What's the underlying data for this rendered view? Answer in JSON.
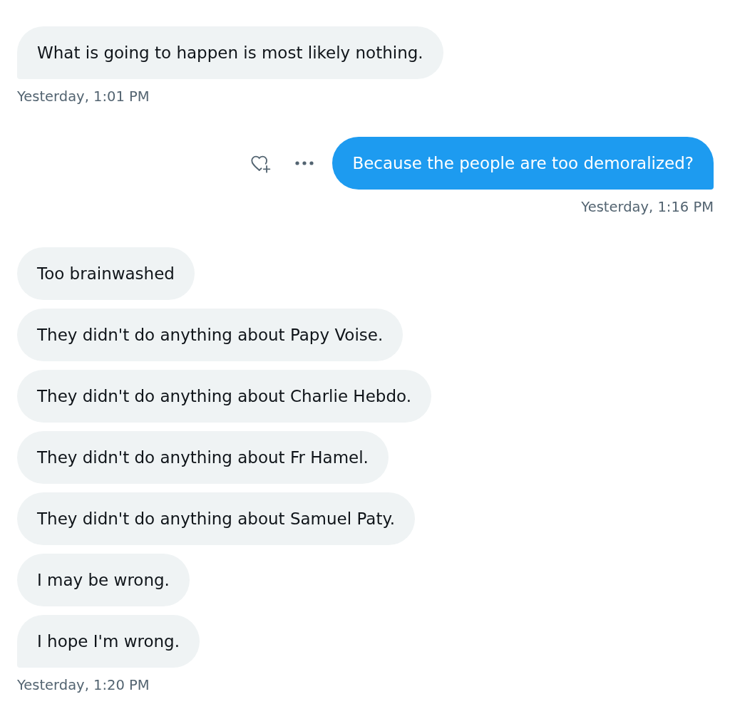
{
  "messages": [
    {
      "kind": "received",
      "bubbles": [
        {
          "text": "What is going to happen is most likely nothing.",
          "hovered": false
        }
      ],
      "timestamp": "Yesterday, 1:01 PM"
    },
    {
      "kind": "sent",
      "bubbles": [
        {
          "text": "Because the people are too demoralized?",
          "hovered": true
        }
      ],
      "timestamp": "Yesterday, 1:16 PM"
    },
    {
      "kind": "received",
      "bubbles": [
        {
          "text": "Too brainwashed",
          "hovered": false
        },
        {
          "text": "They didn't do anything about Papy Voise.",
          "hovered": false
        },
        {
          "text": "They didn't do anything about Charlie Hebdo.",
          "hovered": false
        },
        {
          "text": "They didn't do anything about Fr Hamel.",
          "hovered": false
        },
        {
          "text": "They didn't do anything about Samuel Paty.",
          "hovered": false
        },
        {
          "text": "I may be wrong.",
          "hovered": false
        },
        {
          "text": "I hope I'm wrong.",
          "hovered": false
        }
      ],
      "timestamp": "Yesterday, 1:20 PM"
    }
  ]
}
